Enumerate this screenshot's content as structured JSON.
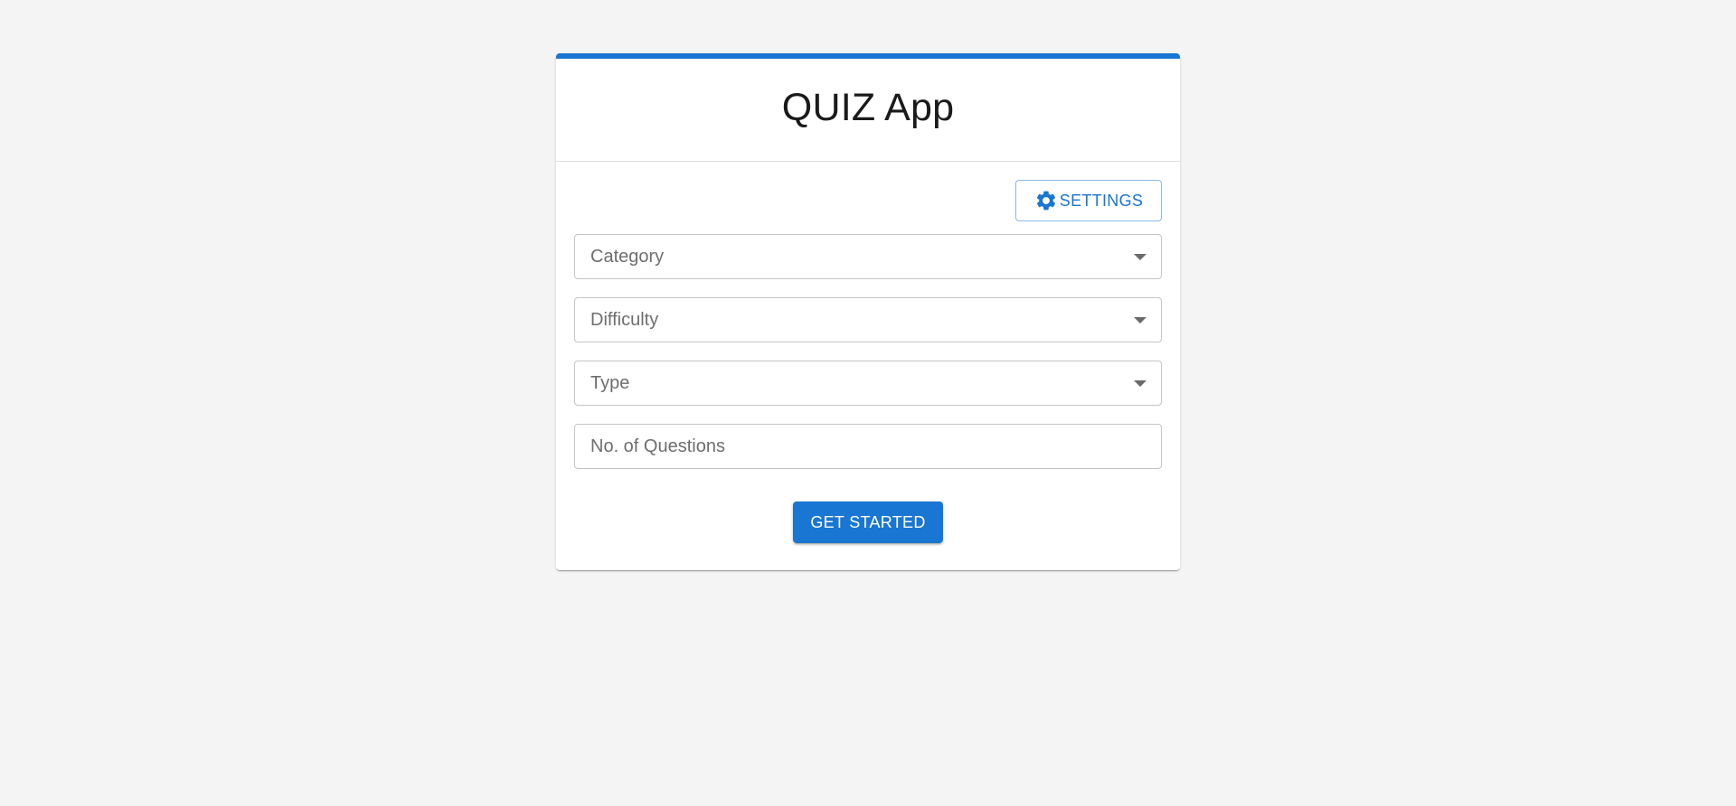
{
  "card": {
    "title": "QUIZ App"
  },
  "settings": {
    "label": "SETTINGS",
    "icon": "gear-icon"
  },
  "form": {
    "category": {
      "label": "Category",
      "icon": "arrow-drop-down-icon"
    },
    "difficulty": {
      "label": "Difficulty",
      "icon": "arrow-drop-down-icon"
    },
    "type": {
      "label": "Type",
      "icon": "arrow-drop-down-icon"
    },
    "questions": {
      "placeholder": "No. of Questions",
      "value": ""
    }
  },
  "actions": {
    "start_label": "GET STARTED"
  },
  "colors": {
    "accent": "#1976d2",
    "background": "#f4f4f4"
  }
}
